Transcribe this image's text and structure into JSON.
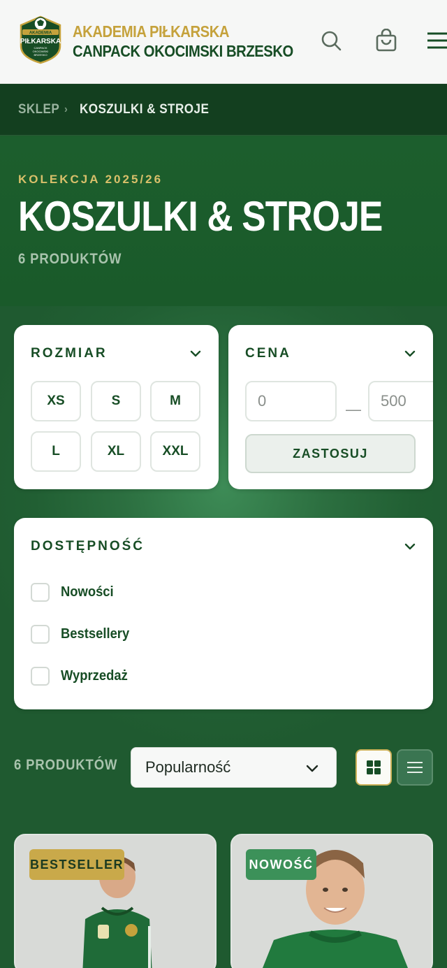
{
  "header": {
    "brand_line1": "AKADEMIA PIŁKARSKA",
    "brand_line2": "CANPACK OKOCIMSKI BRZESKO",
    "logo_text": "AKADEMIA PIŁKARSKA CANPACK OKOCIMSKI BRZESKO",
    "icons": [
      "search-icon",
      "cart-icon",
      "menu-icon"
    ]
  },
  "breadcrumb": {
    "items": [
      "SKLEP",
      "KOSZULKI & STROJE"
    ],
    "separator": "›"
  },
  "hero": {
    "kicker": "KOLEKCJA 2025/26",
    "title": "KOSZULKI & STROJE",
    "count": "6 PRODUKTÓW"
  },
  "filters": {
    "size": {
      "title": "ROZMIAR",
      "options": [
        "XS",
        "S",
        "M",
        "L",
        "XL",
        "XXL"
      ]
    },
    "price": {
      "title": "CENA",
      "min_value": "0",
      "max_value": "500",
      "separator": "—",
      "apply_label": "ZASTOSUJ"
    },
    "availability": {
      "title": "DOSTĘPNOŚĆ",
      "options": [
        "Nowości",
        "Bestsellery",
        "Wyprzedaż"
      ]
    }
  },
  "toolbar": {
    "count": "6 PRODUKTÓW",
    "sort_selected": "Popularność",
    "view_modes": [
      "grid",
      "list"
    ],
    "active_view": "grid"
  },
  "products": [
    {
      "badge": "BESTSELLER"
    },
    {
      "badge": "NOWOŚĆ"
    }
  ],
  "colors": {
    "brand_green": "#174d25",
    "brand_gold": "#c5a23c",
    "badge_gold": "#c9a94a",
    "badge_green": "#3c9159"
  }
}
